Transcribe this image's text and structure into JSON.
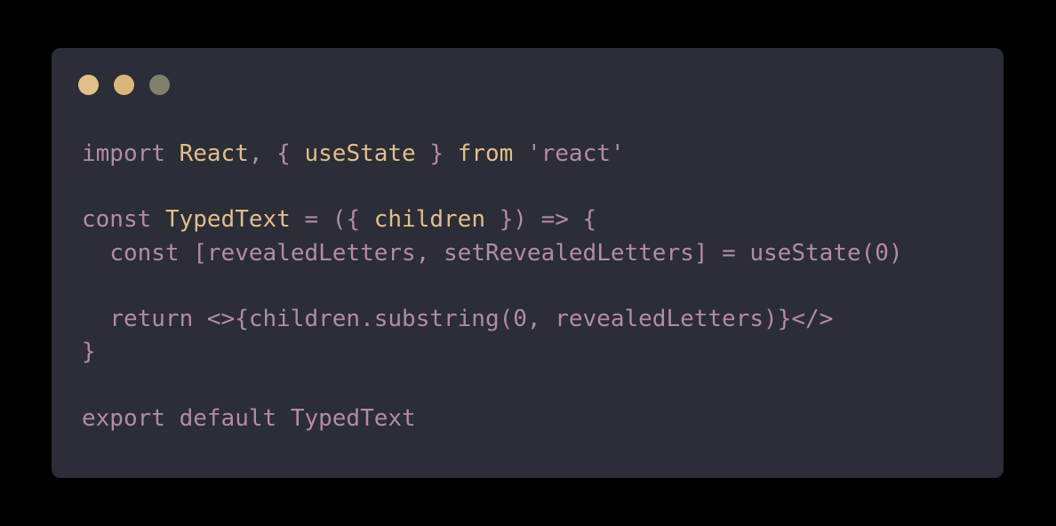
{
  "window": {
    "controls": [
      {
        "name": "close-dot",
        "color": "#e2be8c"
      },
      {
        "name": "minimize-dot",
        "color": "#d9b67a"
      },
      {
        "name": "maximize-dot",
        "color": "#80806c"
      }
    ]
  },
  "colors": {
    "background": "#000000",
    "panel": "#2b2d37",
    "keyword": "#b48aa7",
    "identifier": "#e2be8c"
  },
  "code": {
    "lines": [
      [
        {
          "t": "import",
          "k": "kw"
        },
        {
          "t": " "
        },
        {
          "t": "React",
          "k": "id"
        },
        {
          "t": ", { ",
          "k": "pl"
        },
        {
          "t": "useState",
          "k": "id"
        },
        {
          "t": " } ",
          "k": "pl"
        },
        {
          "t": "from",
          "k": "id"
        },
        {
          "t": " "
        },
        {
          "t": "'react'",
          "k": "st"
        }
      ],
      [],
      [
        {
          "t": "const",
          "k": "kw"
        },
        {
          "t": " "
        },
        {
          "t": "TypedText",
          "k": "id"
        },
        {
          "t": " = ({ ",
          "k": "pl"
        },
        {
          "t": "children",
          "k": "id"
        },
        {
          "t": " }) => {",
          "k": "pl"
        }
      ],
      [
        {
          "t": "  "
        },
        {
          "t": "const",
          "k": "kw"
        },
        {
          "t": " [revealedLetters, setRevealedLetters] = useState(0)",
          "k": "pl"
        }
      ],
      [],
      [
        {
          "t": "  "
        },
        {
          "t": "return",
          "k": "kw"
        },
        {
          "t": " <>{children.substring(0, revealedLetters)}</>",
          "k": "pl"
        }
      ],
      [
        {
          "t": "}",
          "k": "pl"
        }
      ],
      [],
      [
        {
          "t": "export",
          "k": "kw"
        },
        {
          "t": " "
        },
        {
          "t": "default",
          "k": "kw"
        },
        {
          "t": " "
        },
        {
          "t": "TypedText",
          "k": "kw"
        }
      ]
    ]
  }
}
